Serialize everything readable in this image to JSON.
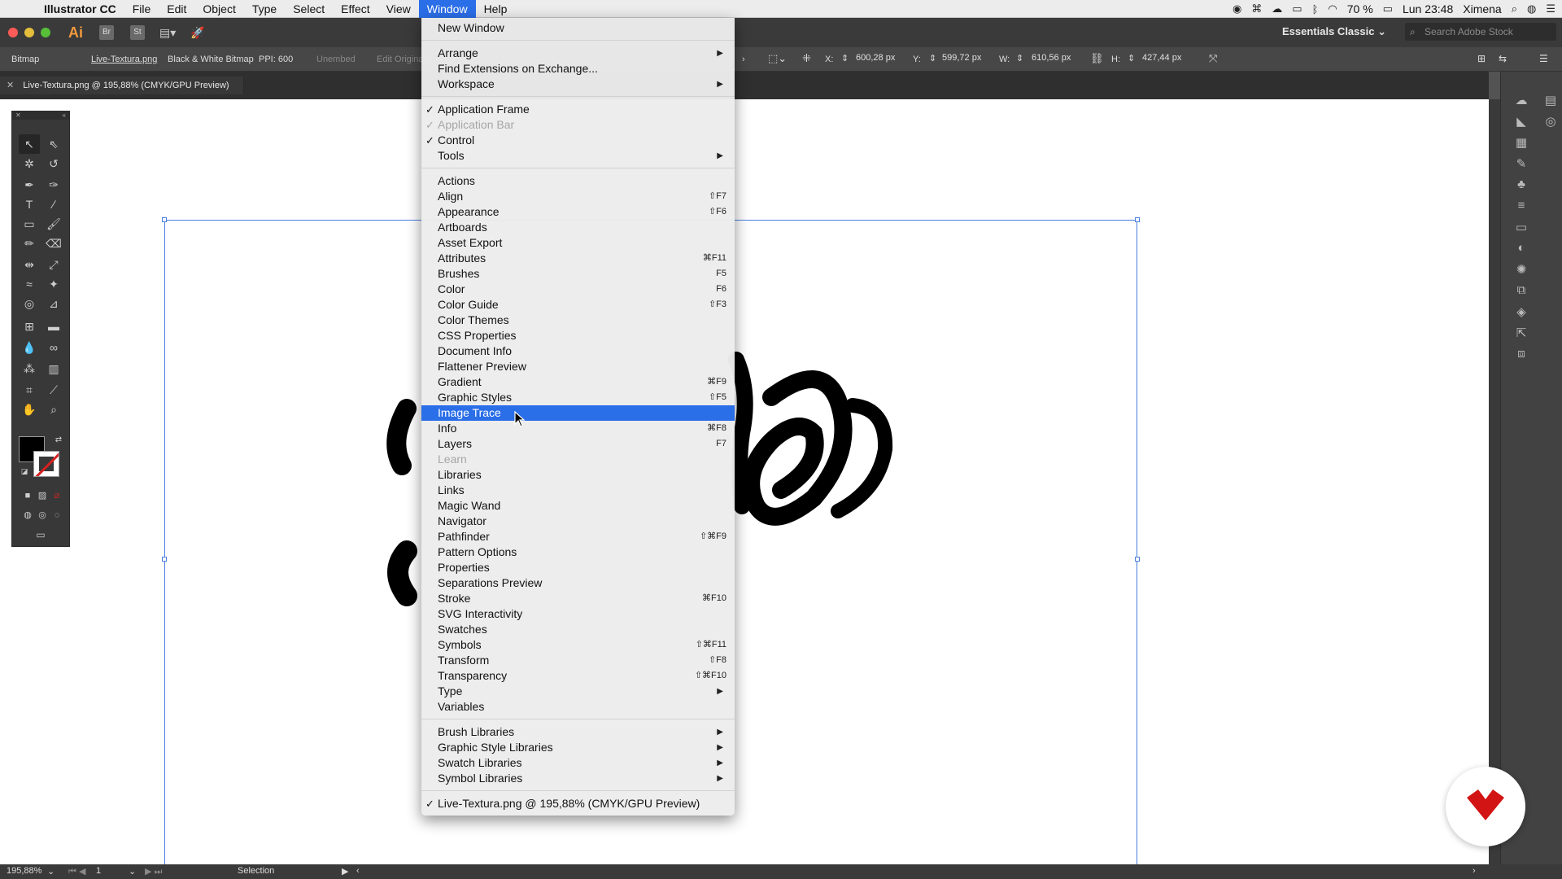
{
  "menubar": {
    "app_name": "Illustrator CC",
    "menus": [
      "File",
      "Edit",
      "Object",
      "Type",
      "Select",
      "Effect",
      "View",
      "Window",
      "Help"
    ],
    "active_menu": "Window",
    "battery": "70 %",
    "clock": "Lun 23:48",
    "user": "Ximena"
  },
  "appbar": {
    "logo": "Ai",
    "bridge": "Br",
    "stock": "St",
    "workspace": "Essentials Classic",
    "search_placeholder": "Search Adobe Stock"
  },
  "control": {
    "object_type": "Bitmap",
    "file": "Live-Textura.png",
    "mode": "Black & White Bitmap",
    "ppi": "PPI: 600",
    "unembed": "Unembed",
    "edit_original": "Edit Original",
    "x_label": "X:",
    "x_value": "600,28 px",
    "y_label": "Y:",
    "y_value": "599,72 px",
    "w_label": "W:",
    "w_value": "610,56 px",
    "h_label": "H:",
    "h_value": "427,44 px"
  },
  "document": {
    "tab_title": "Live-Textura.png @ 195,88% (CMYK/GPU Preview)"
  },
  "status": {
    "zoom": "195,88%",
    "artboard": "1",
    "tool": "Selection"
  },
  "window_menu": {
    "items": [
      {
        "label": "New Window"
      },
      {
        "label": "Arrange",
        "submenu": "▶"
      },
      {
        "label": "Find Extensions on Exchange..."
      },
      {
        "label": "Workspace",
        "submenu": "▶"
      },
      {
        "label": "Application Frame",
        "check": "✓"
      },
      {
        "label": "Application Bar",
        "check": "✓",
        "disabled": true
      },
      {
        "label": "Control",
        "check": "✓"
      },
      {
        "label": "Tools",
        "submenu": "▶"
      },
      {
        "label": "Actions"
      },
      {
        "label": "Align",
        "shortcut": "⇧F7"
      },
      {
        "label": "Appearance",
        "shortcut": "⇧F6"
      },
      {
        "label": "Artboards"
      },
      {
        "label": "Asset Export"
      },
      {
        "label": "Attributes",
        "shortcut": "⌘F11"
      },
      {
        "label": "Brushes",
        "shortcut": "F5"
      },
      {
        "label": "Color",
        "shortcut": "F6"
      },
      {
        "label": "Color Guide",
        "shortcut": "⇧F3"
      },
      {
        "label": "Color Themes"
      },
      {
        "label": "CSS Properties"
      },
      {
        "label": "Document Info"
      },
      {
        "label": "Flattener Preview"
      },
      {
        "label": "Gradient",
        "shortcut": "⌘F9"
      },
      {
        "label": "Graphic Styles",
        "shortcut": "⇧F5"
      },
      {
        "label": "Image Trace",
        "highlighted": true
      },
      {
        "label": "Info",
        "shortcut": "⌘F8"
      },
      {
        "label": "Layers",
        "shortcut": "F7"
      },
      {
        "label": "Learn",
        "disabled": true
      },
      {
        "label": "Libraries"
      },
      {
        "label": "Links"
      },
      {
        "label": "Magic Wand"
      },
      {
        "label": "Navigator"
      },
      {
        "label": "Pathfinder",
        "shortcut": "⇧⌘F9"
      },
      {
        "label": "Pattern Options"
      },
      {
        "label": "Properties"
      },
      {
        "label": "Separations Preview"
      },
      {
        "label": "Stroke",
        "shortcut": "⌘F10"
      },
      {
        "label": "SVG Interactivity"
      },
      {
        "label": "Swatches"
      },
      {
        "label": "Symbols",
        "shortcut": "⇧⌘F11"
      },
      {
        "label": "Transform",
        "shortcut": "⇧F8"
      },
      {
        "label": "Transparency",
        "shortcut": "⇧⌘F10"
      },
      {
        "label": "Type",
        "submenu": "▶"
      },
      {
        "label": "Variables"
      },
      {
        "label": "Brush Libraries",
        "submenu": "▶"
      },
      {
        "label": "Graphic Style Libraries",
        "submenu": "▶"
      },
      {
        "label": "Swatch Libraries",
        "submenu": "▶"
      },
      {
        "label": "Symbol Libraries",
        "submenu": "▶"
      },
      {
        "label": "Live-Textura.png @ 195,88% (CMYK/GPU Preview)",
        "check": "✓"
      }
    ]
  },
  "colors": {
    "menu_highlight": "#2a6ee8",
    "selection_blue": "#4a7ee0",
    "brand_red": "#d21414",
    "ai_orange": "#f29a3e"
  }
}
